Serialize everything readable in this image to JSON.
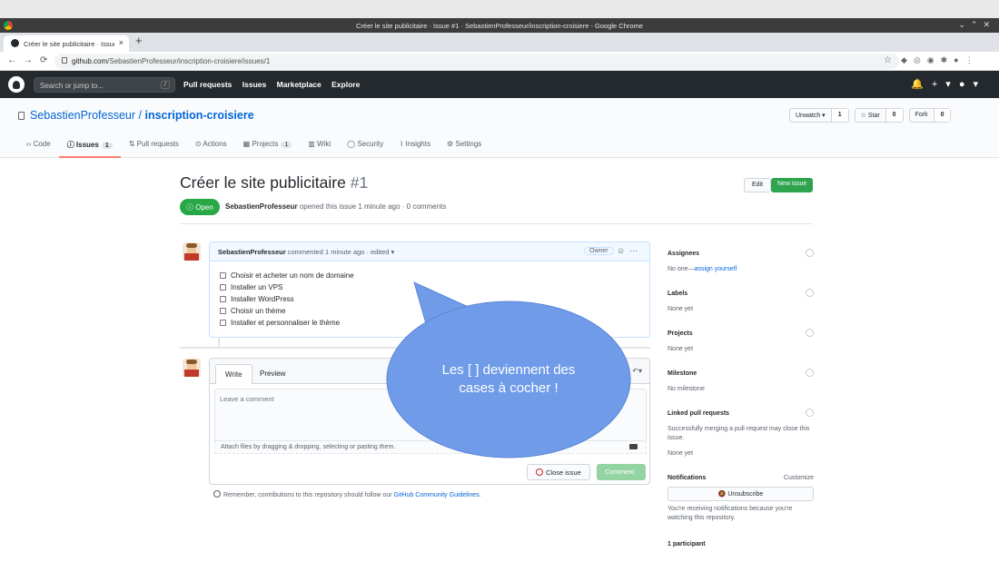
{
  "window": {
    "title": "Créer le site publicitaire · Issue #1 · SebastienProfesseur/inscription-croisiere - Google Chrome"
  },
  "tab": {
    "title": "Créer le site publicitaire · Issue #1",
    "close": "×",
    "new_tab": "+"
  },
  "address": {
    "host": "github.com",
    "path": "/SebastienProfesseur/inscription-croisiere/issues/1"
  },
  "github_header": {
    "search_placeholder": "Search or jump to...",
    "slash_key": "/",
    "nav": [
      "Pull requests",
      "Issues",
      "Marketplace",
      "Explore"
    ]
  },
  "repo": {
    "owner": "SebastienProfesseur",
    "separator": "/",
    "name": "inscription-croisiere",
    "buttons": [
      {
        "label": "Unwatch ▾",
        "count": "1"
      },
      {
        "label": "☆ Star",
        "count": "0"
      },
      {
        "label": "Fork",
        "count": "0"
      }
    ],
    "tabs": [
      {
        "label": "Code",
        "icon": "code-icon"
      },
      {
        "label": "Issues",
        "icon": "issue-icon",
        "count": "1"
      },
      {
        "label": "Pull requests",
        "icon": "pull-request-icon"
      },
      {
        "label": "Actions",
        "icon": "play-icon"
      },
      {
        "label": "Projects",
        "icon": "project-icon",
        "count": "1"
      },
      {
        "label": "Wiki",
        "icon": "book-icon"
      },
      {
        "label": "Security",
        "icon": "shield-icon"
      },
      {
        "label": "Insights",
        "icon": "graph-icon"
      },
      {
        "label": "Settings",
        "icon": "gear-icon"
      }
    ]
  },
  "issue": {
    "title": "Créer le site publicitaire",
    "number": "#1",
    "edit_label": "Edit",
    "new_issue_label": "New issue",
    "state": "Open",
    "author": "SebastienProfesseur",
    "meta": "opened this issue 1 minute ago · 0 comments"
  },
  "comment": {
    "author": "SebastienProfesseur",
    "meta": "commented 1 minute ago · edited ▾",
    "badge": "Owner",
    "tasks": [
      "Choisir et acheter un nom de domaine",
      "Installer un VPS",
      "Installer WordPress",
      "Choisir un thème",
      "Installer et personnaliser le thème"
    ]
  },
  "form": {
    "tab_write": "Write",
    "tab_preview": "Preview",
    "placeholder": "Leave a comment",
    "attach_text": "Attach files by dragging & dropping, selecting or pasting them.",
    "close_label": "Close issue",
    "comment_label": "Comment",
    "guidelines_text": "Remember, contributions to this repository should follow our",
    "guidelines_link": "GitHub Community Guidelines",
    "guidelines_end": "."
  },
  "sidebar": {
    "assignees_title": "Assignees",
    "assignees_value": "No one—",
    "assign_yourself": "assign yourself",
    "labels_title": "Labels",
    "labels_value": "None yet",
    "projects_title": "Projects",
    "projects_value": "None yet",
    "milestone_title": "Milestone",
    "milestone_value": "No milestone",
    "linked_title": "Linked pull requests",
    "linked_desc": "Successfully merging a pull request may close this issue.",
    "linked_value": "None yet",
    "notifications_title": "Notifications",
    "customize": "Customize",
    "unsubscribe": "Unsubscribe",
    "notifications_desc": "You're receiving notifications because you're watching this repository.",
    "participants": "1 participant"
  },
  "callout": {
    "line1": "Les [ ] deviennent des",
    "line2": "cases à cocher !",
    "color": "#6f9be8"
  },
  "colors": {
    "github_dark": "#24292e",
    "open_green": "#28a745",
    "link_blue": "#0366d6",
    "tab_underline": "#f9826c"
  }
}
